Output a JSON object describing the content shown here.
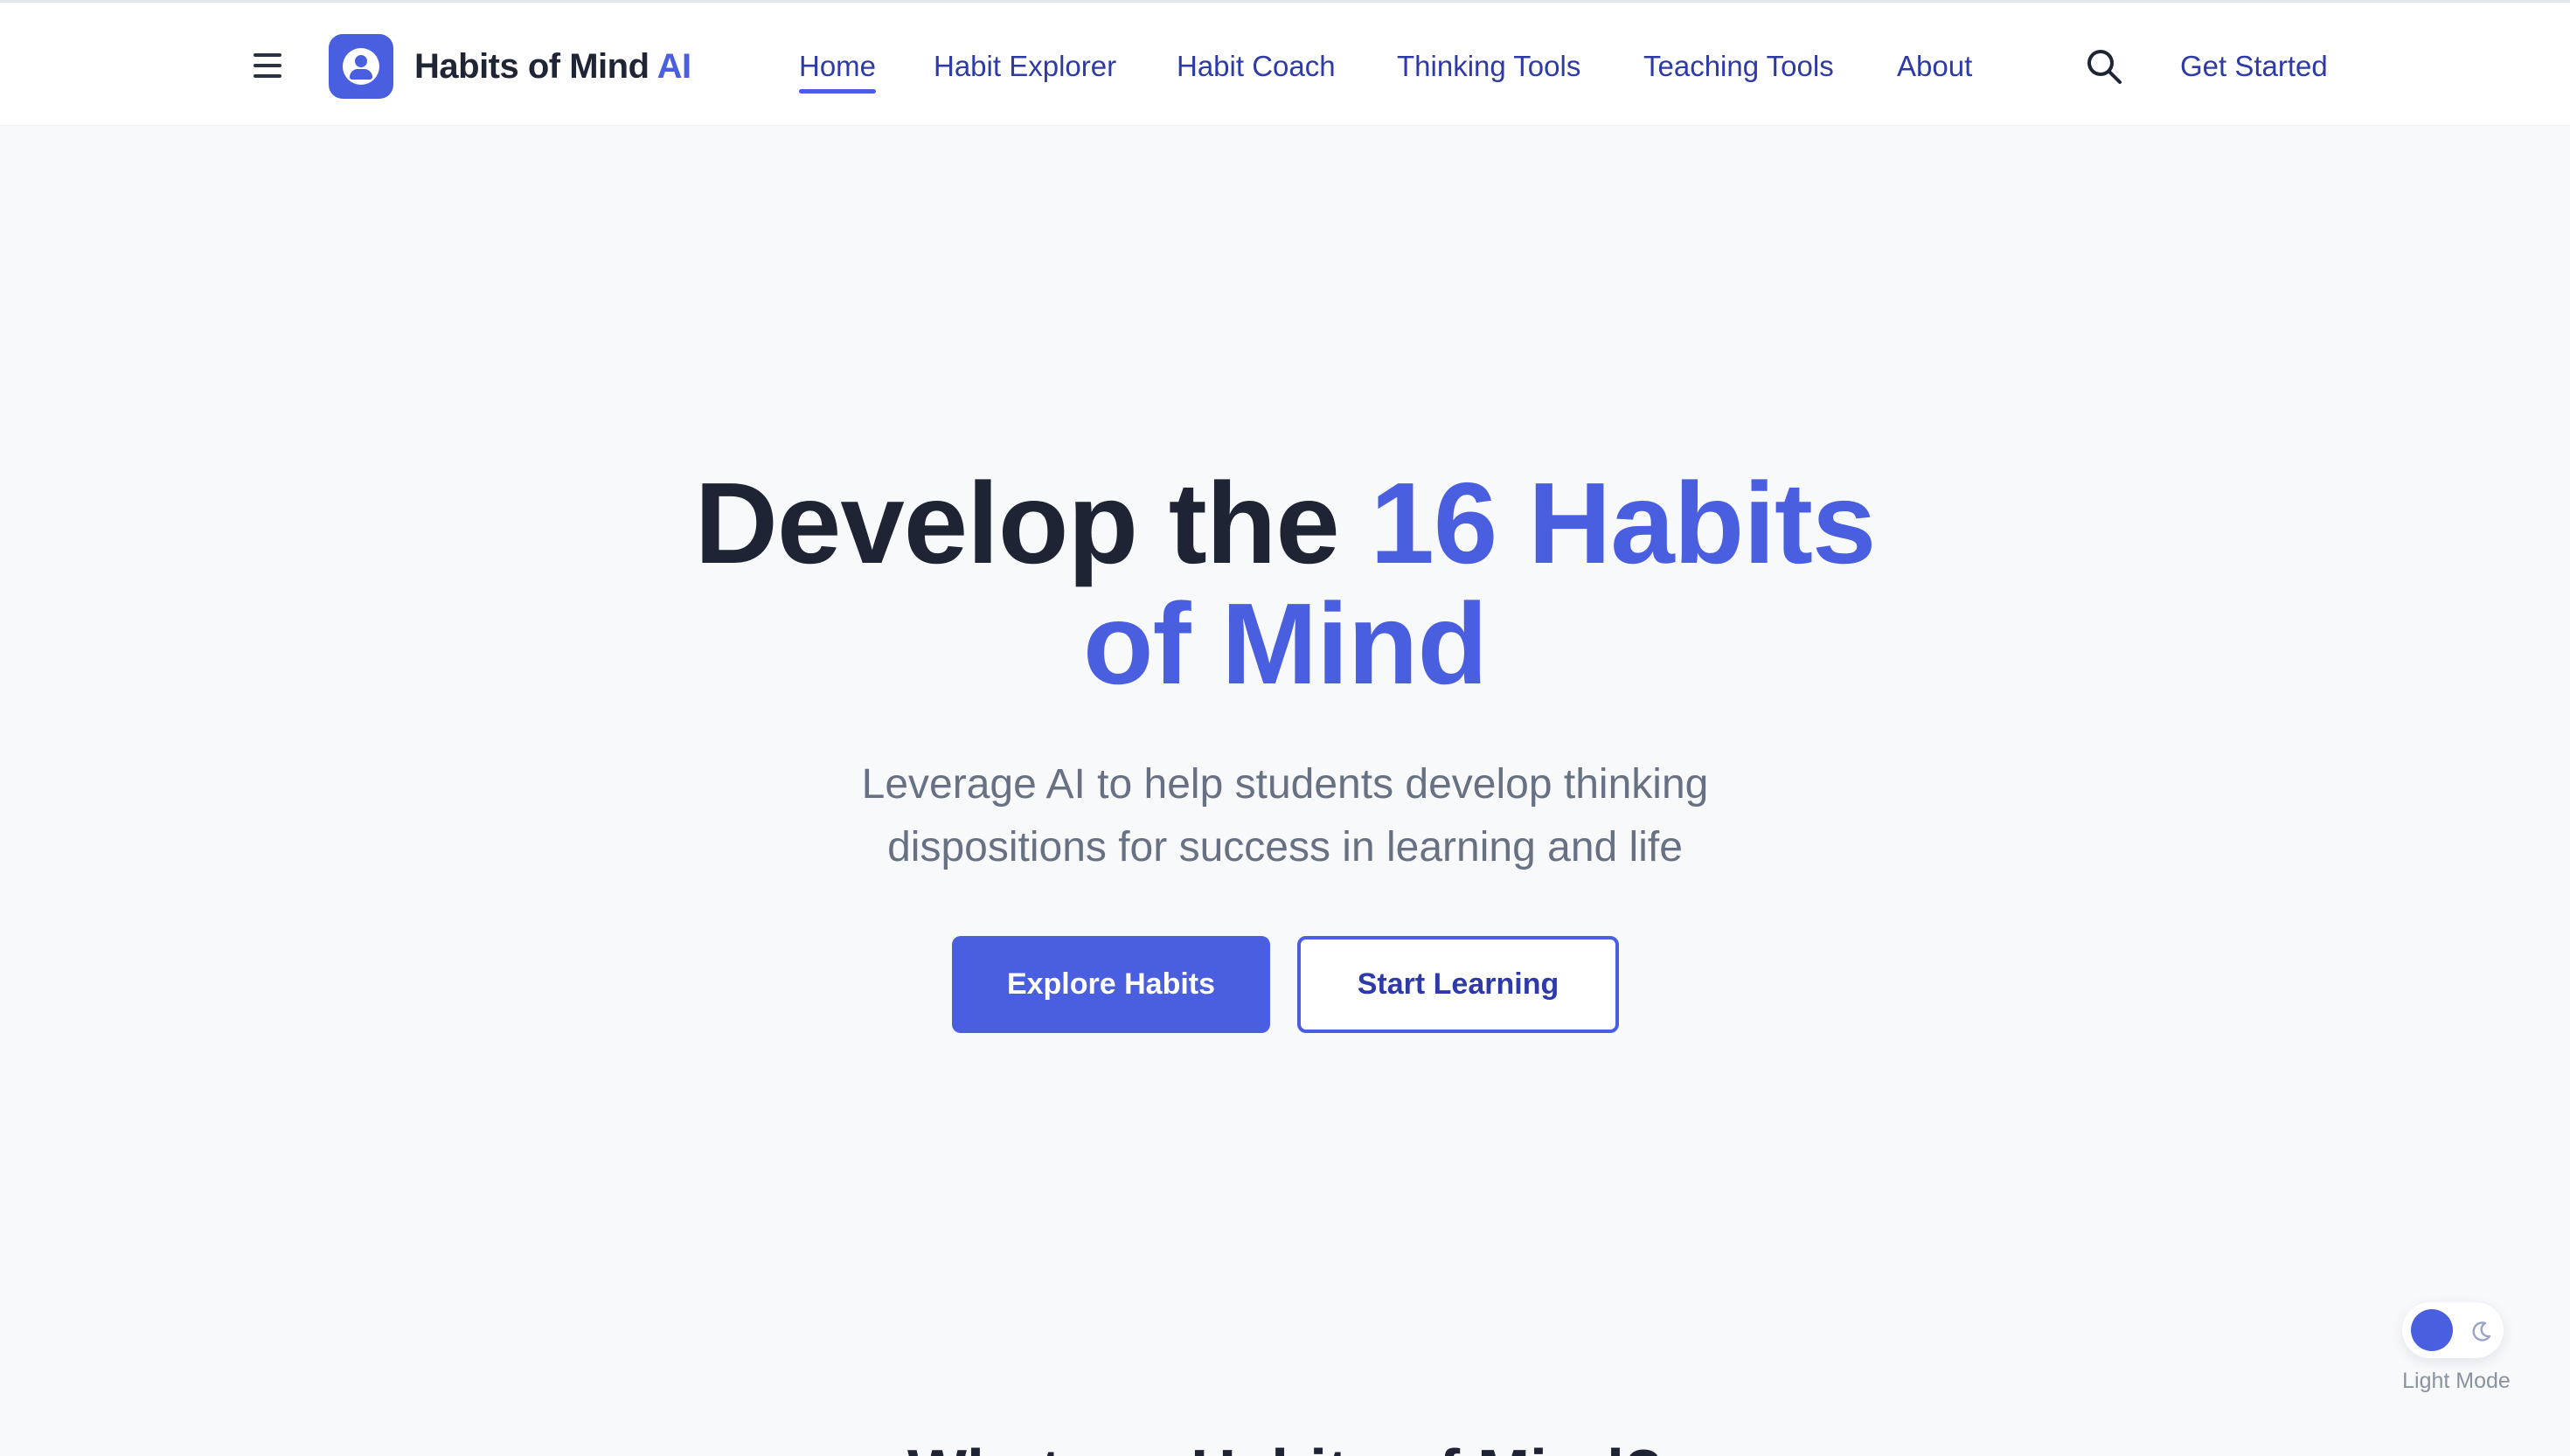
{
  "header": {
    "brand_name": "Habits of Mind",
    "brand_accent": "AI",
    "nav": [
      {
        "label": "Home",
        "active": true
      },
      {
        "label": "Habit Explorer",
        "active": false
      },
      {
        "label": "Habit Coach",
        "active": false
      },
      {
        "label": "Thinking Tools",
        "active": false
      },
      {
        "label": "Teaching Tools",
        "active": false
      },
      {
        "label": "About",
        "active": false
      }
    ],
    "cta_label": "Get Started",
    "icons": {
      "menu": "menu-icon",
      "logo": "user-circle-icon",
      "search": "search-icon"
    }
  },
  "hero": {
    "title_part1": "Develop the ",
    "title_accent_line1": "16 Habits",
    "title_accent_line2": "of Mind",
    "subtitle_line1": "Leverage AI to help students develop thinking",
    "subtitle_line2": "dispositions for success in learning and life",
    "primary_button": "Explore Habits",
    "secondary_button": "Start Learning"
  },
  "next_section": {
    "heading": "What are Habits of Mind?"
  },
  "theme_toggle": {
    "label": "Light Mode",
    "icon": "moon-icon"
  },
  "colors": {
    "accent": "#4a5ee0",
    "nav_text": "#2d3aa8",
    "heading": "#1e2433",
    "muted": "#687184",
    "background": "#f8f9fb"
  }
}
